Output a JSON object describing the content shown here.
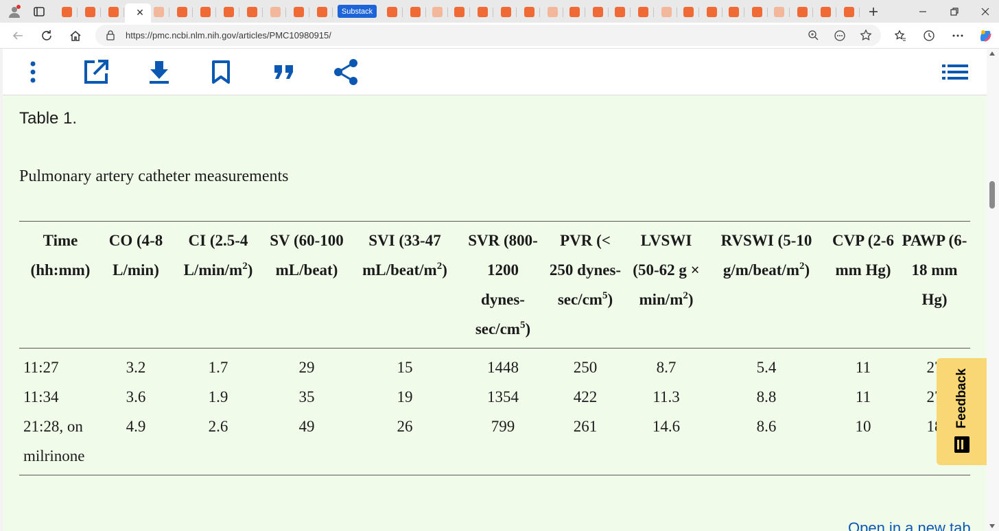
{
  "browser": {
    "url": "https://pmc.ncbi.nlm.nih.gov/articles/PMC10980915/",
    "substack_tab_label": "Substack",
    "active_tab_close": "✕",
    "colors": {
      "tab_orange": "#f06a35",
      "substack_blue": "#1c64d8",
      "accent": "#0b58b3"
    }
  },
  "toolbar": {
    "icons": [
      "more-vertical-icon",
      "open-external-icon",
      "download-icon",
      "bookmark-icon",
      "cite-quote-icon",
      "share-icon",
      "table-of-contents-icon"
    ]
  },
  "table": {
    "label": "Table 1.",
    "title": "Pulmonary artery catheter measurements",
    "headers": [
      {
        "text": "Time (hh:mm)",
        "sup": ""
      },
      {
        "text": "CO (4-8 L/min)",
        "sup": ""
      },
      {
        "text": "CI (2.5-4 L/min/m",
        "sup": "2",
        "tail": ")"
      },
      {
        "text": "SV (60-100 mL/beat)",
        "sup": ""
      },
      {
        "text": "SVI (33-47 mL/beat/m",
        "sup": "2",
        "tail": ")"
      },
      {
        "text": "SVR (800-1200 dynes-sec/cm",
        "sup": "5",
        "tail": ")"
      },
      {
        "text": "PVR (< 250 dynes-sec/cm",
        "sup": "5",
        "tail": ")"
      },
      {
        "text": "LVSWI (50-62 g × min/m",
        "sup": "2",
        "tail": ")"
      },
      {
        "text": "RVSWI (5-10 g/m/beat/m",
        "sup": "2",
        "tail": ")"
      },
      {
        "text": "CVP (2-6 mm Hg)",
        "sup": ""
      },
      {
        "text": "PAWP (6-18 mm Hg)",
        "sup": ""
      }
    ],
    "rows": [
      [
        "11:27",
        "3.2",
        "1.7",
        "29",
        "15",
        "1448",
        "250",
        "8.7",
        "5.4",
        "11",
        "27"
      ],
      [
        "11:34",
        "3.6",
        "1.9",
        "35",
        "19",
        "1354",
        "422",
        "11.3",
        "8.8",
        "11",
        "27"
      ],
      [
        "21:28, on milrinone",
        "4.9",
        "2.6",
        "49",
        "26",
        "799",
        "261",
        "14.6",
        "8.6",
        "10",
        "18"
      ]
    ]
  },
  "feedback": {
    "label": "Feedback"
  },
  "footer": {
    "open_new_tab": "Open in a new tab"
  }
}
